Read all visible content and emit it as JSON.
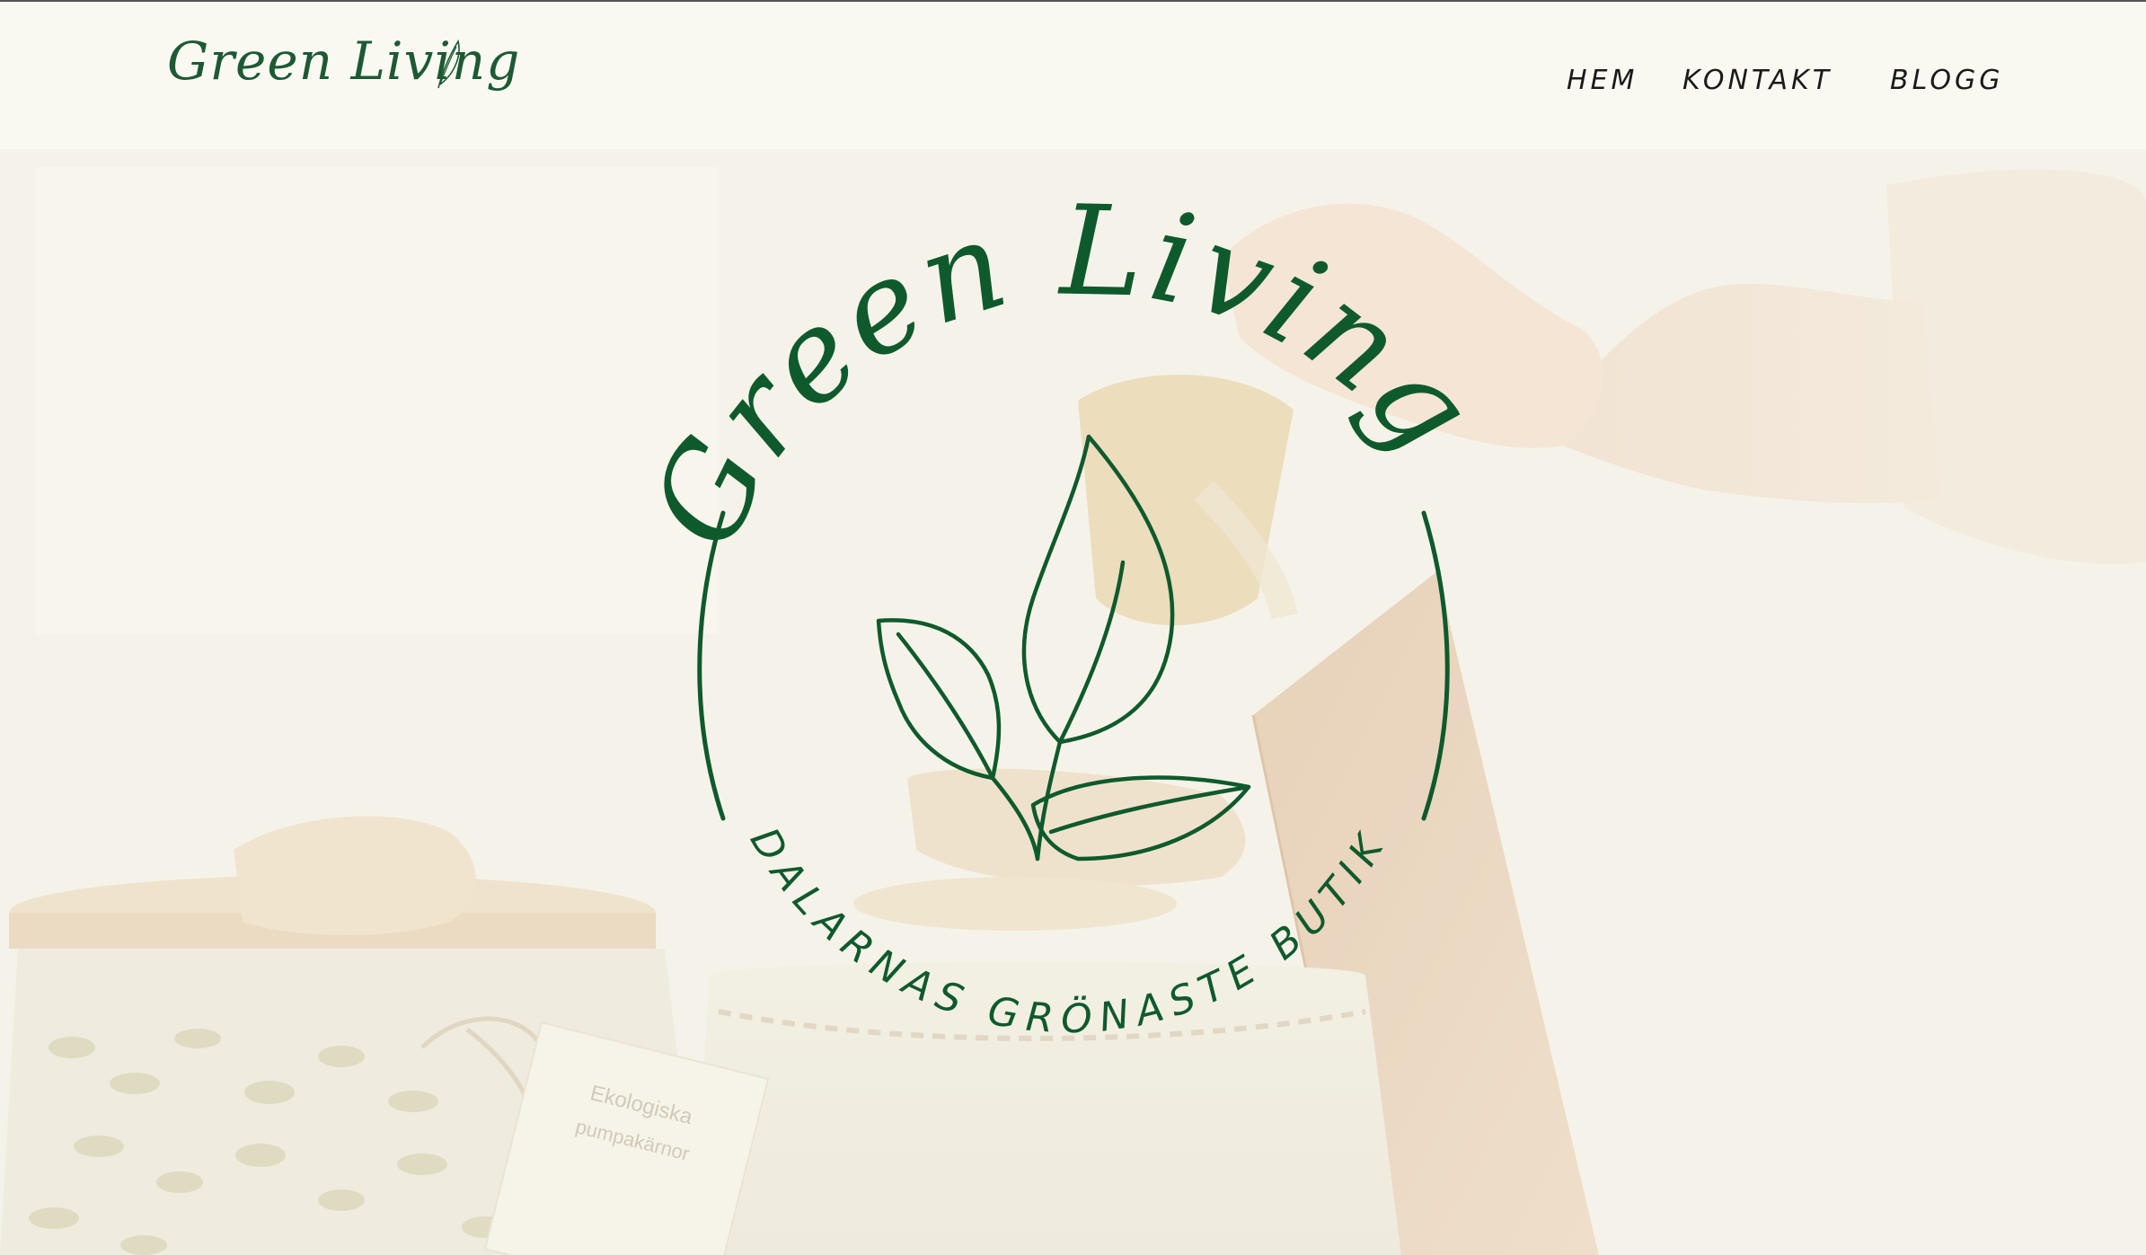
{
  "header": {
    "logo_text": "Green Living",
    "nav": [
      {
        "label": "HEM"
      },
      {
        "label": "KONTAKT"
      },
      {
        "label": "BLOGG"
      }
    ]
  },
  "hero": {
    "emblem_title": "Green Living",
    "emblem_tagline": "DALARNAS GRÖNASTE BUTIK",
    "jar_label_line1": "Ekologiska",
    "jar_label_line2": "pumpakärnor"
  },
  "icons": [
    "leaf-icon",
    "leaves-emblem-icon"
  ],
  "colors": {
    "brand_green": "#0f5a2c",
    "header_bg": "#f9f9f2",
    "nav_text": "#1a1a1a"
  }
}
